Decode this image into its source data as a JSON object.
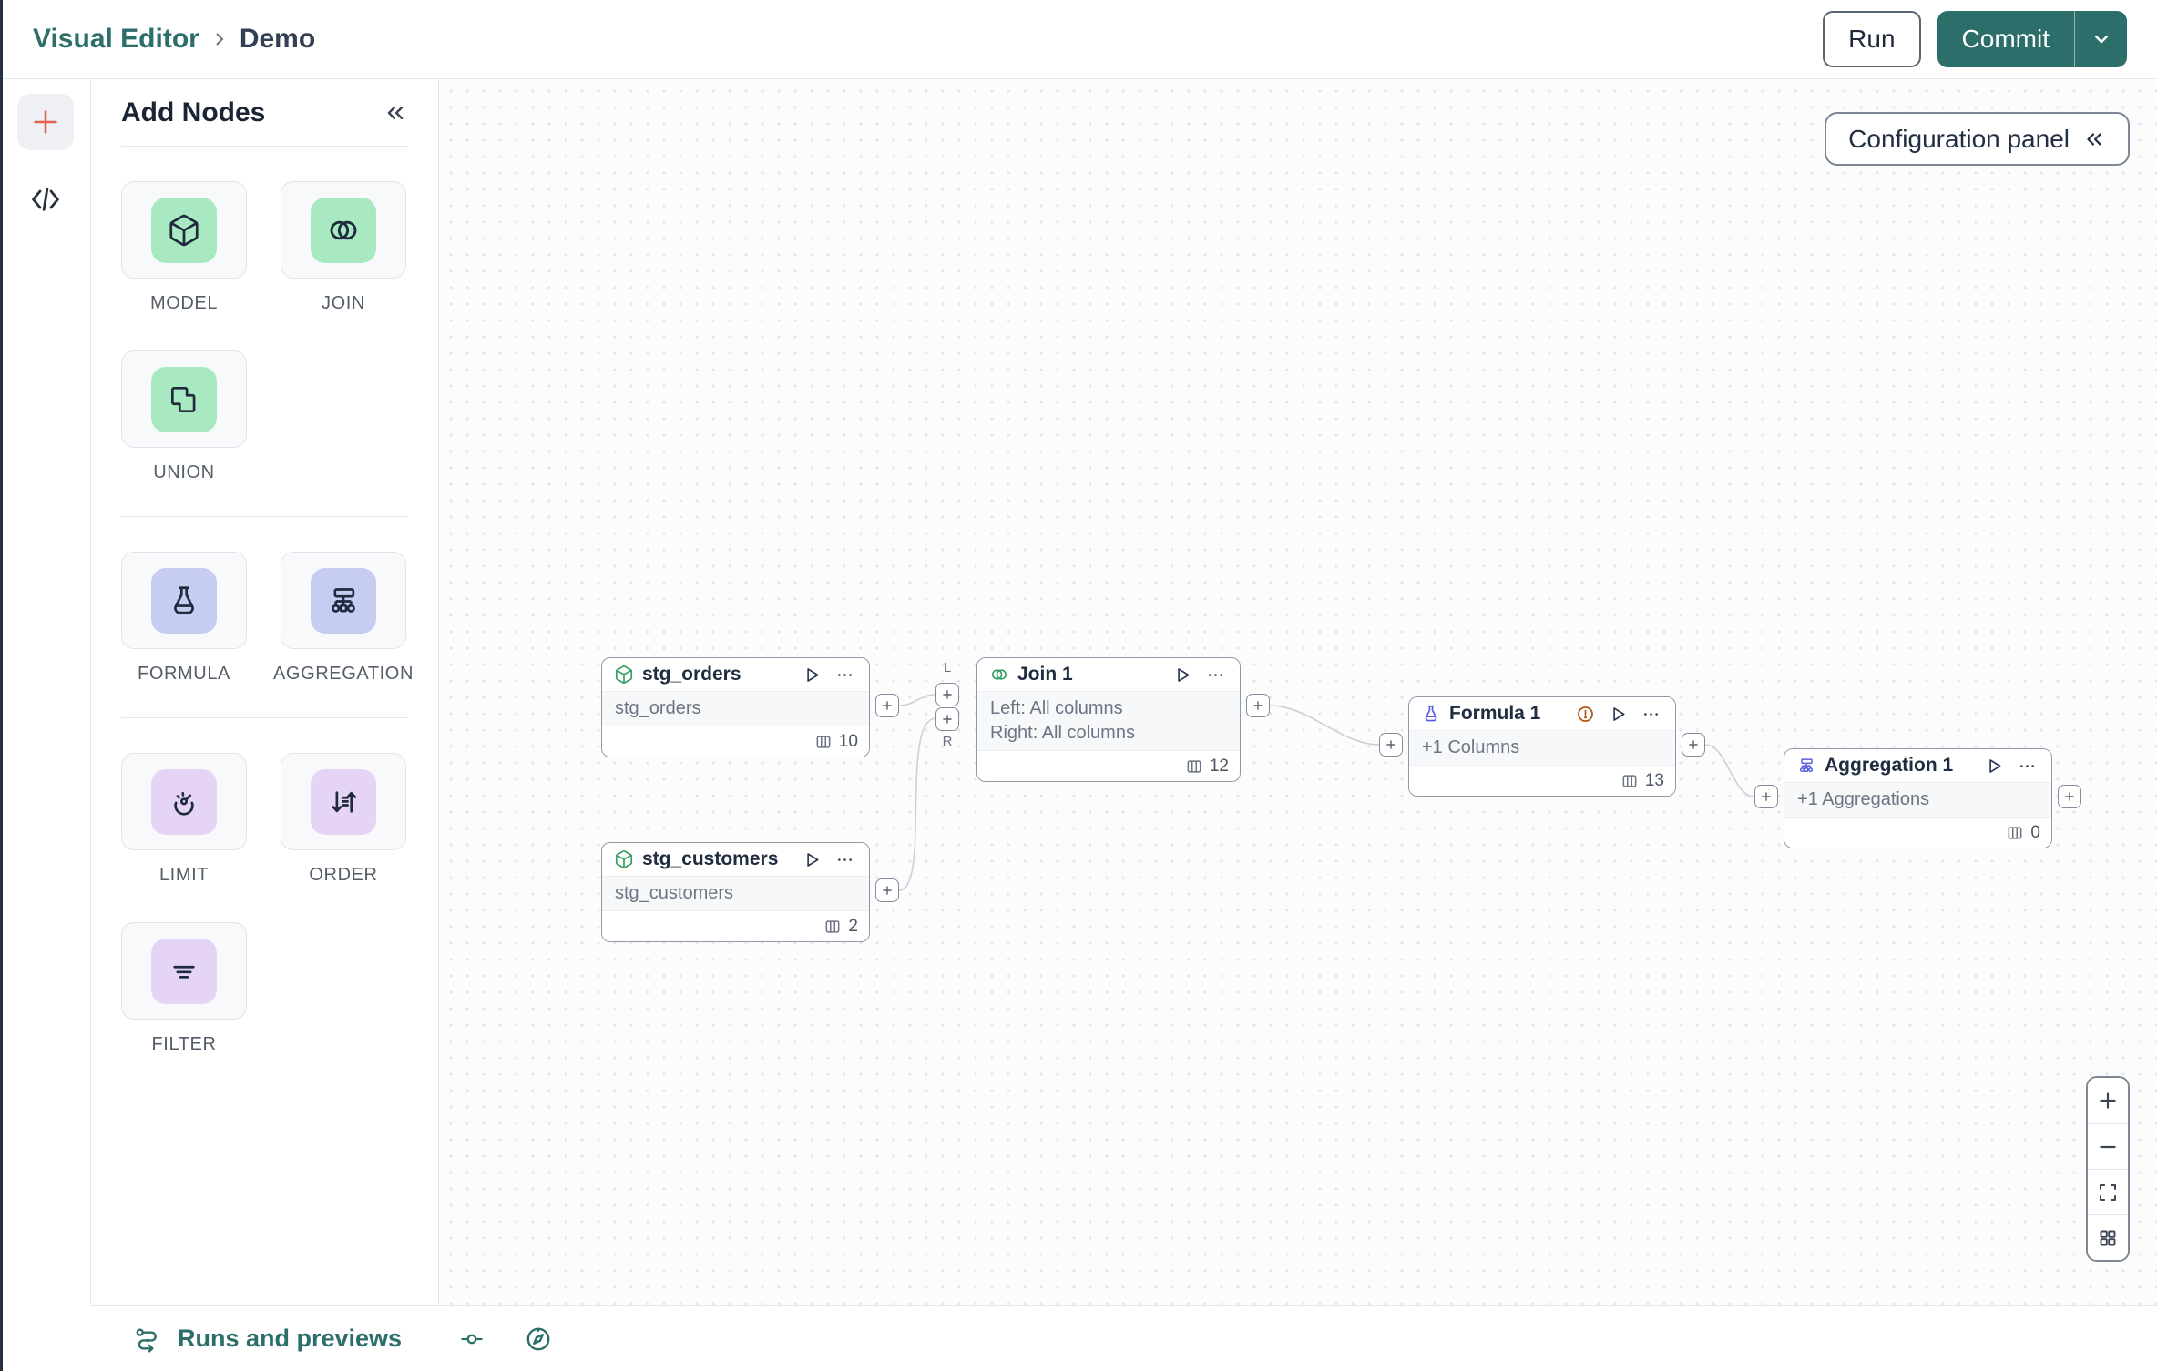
{
  "header": {
    "breadcrumb": {
      "root": "Visual Editor",
      "current": "Demo"
    },
    "run_button": "Run",
    "commit_button": "Commit"
  },
  "panel": {
    "title": "Add Nodes",
    "groups": [
      {
        "tiles": [
          {
            "label": "MODEL",
            "icon": "cube-icon"
          },
          {
            "label": "JOIN",
            "icon": "join-circles-icon"
          },
          {
            "label": "UNION",
            "icon": "union-shapes-icon"
          }
        ]
      },
      {
        "tiles": [
          {
            "label": "FORMULA",
            "icon": "flask-icon"
          },
          {
            "label": "AGGREGATION",
            "icon": "aggregation-tree-icon"
          }
        ]
      },
      {
        "tiles": [
          {
            "label": "LIMIT",
            "icon": "gauge-icon"
          },
          {
            "label": "ORDER",
            "icon": "sort-arrows-icon"
          },
          {
            "label": "FILTER",
            "icon": "filter-lines-icon"
          }
        ]
      }
    ]
  },
  "canvas": {
    "config_panel_button": "Configuration panel",
    "nodes": [
      {
        "title": "stg_orders",
        "icon": "model-cube-icon",
        "body_lines": [
          "stg_orders"
        ],
        "column_count": "10"
      },
      {
        "title": "stg_customers",
        "icon": "model-cube-icon",
        "body_lines": [
          "stg_customers"
        ],
        "column_count": "2"
      },
      {
        "title": "Join 1",
        "icon": "join-circles-icon",
        "body_lines": [
          "Left: All columns",
          "Right: All columns"
        ],
        "column_count": "12",
        "input_labels": {
          "left": "L",
          "right": "R"
        }
      },
      {
        "title": "Formula 1",
        "icon": "flask-icon",
        "body_lines": [
          "+1 Columns"
        ],
        "column_count": "13",
        "has_warning": true
      },
      {
        "title": "Aggregation 1",
        "icon": "aggregation-tree-icon",
        "body_lines": [
          "+1 Aggregations"
        ],
        "column_count": "0"
      }
    ]
  },
  "bottom_bar": {
    "runs_label": "Runs and previews"
  },
  "colors": {
    "accent_teal": "#2C6E69",
    "coral_plus": "#E4604E",
    "green_tile": "#A9E9C2",
    "lavender_tile": "#C7CCF3",
    "lilac_tile": "#E6D4F7",
    "node_icon_green": "#319E62",
    "node_icon_indigo": "#585CDF",
    "warning_orange": "#B05417"
  }
}
